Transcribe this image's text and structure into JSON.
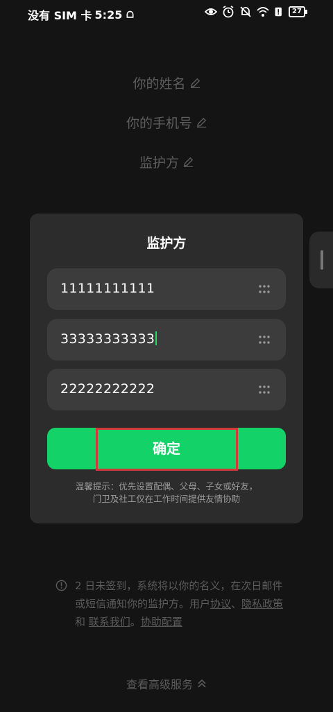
{
  "status_bar": {
    "carrier": "没有 SIM 卡",
    "time": "5:25",
    "battery": "27",
    "icons": [
      "notification-bell-icon",
      "eye-icon",
      "alarm-icon",
      "mute-icon",
      "wifi-icon",
      "alert-icon",
      "battery-icon"
    ]
  },
  "form": {
    "name_label": "你的姓名",
    "phone_label": "你的手机号",
    "guardian_label": "监护方"
  },
  "dialog": {
    "title": "监护方",
    "phones": [
      "11111111111",
      "33333333333",
      "22222222222"
    ],
    "confirm_label": "确定",
    "hint_line1": "温馨提示：优先设置配偶、父母、子女或好友，",
    "hint_line2": "门卫及社工仅在工作时间提供友情协助"
  },
  "notice": {
    "text_part1": "2 日未签到，系统将以你的名义，在次日邮件或短信通知你的监护方。用户",
    "link_agreement": "协议",
    "sep1": "、",
    "link_privacy": "隐私政策",
    "and": " 和 ",
    "link_contact": "联系我们",
    "sep2": "。",
    "link_help": "协助配置"
  },
  "footer": {
    "advanced_label": "查看高级服务"
  },
  "colors": {
    "accent": "#12d268",
    "caret": "#2ad36b",
    "highlight": "#d23a3a",
    "background": "#141414",
    "dialog": "#2c2c2c"
  }
}
